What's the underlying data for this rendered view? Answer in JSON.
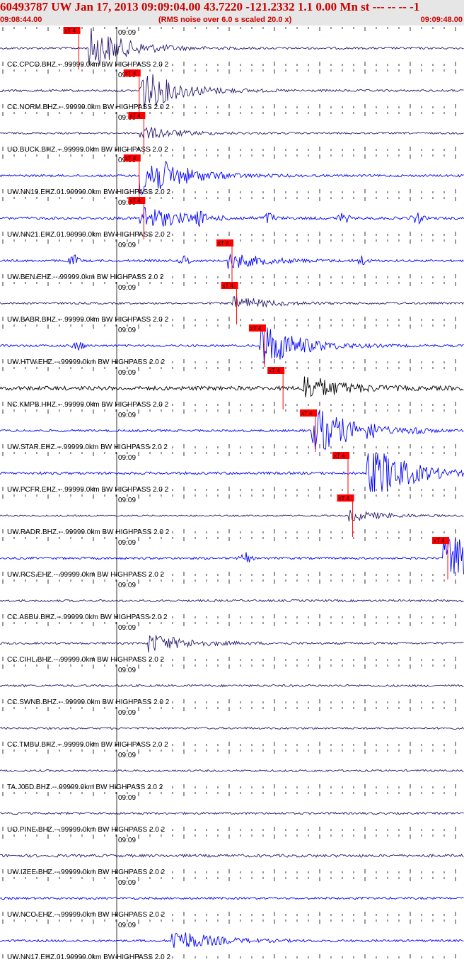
{
  "header": {
    "title": "60493787 UW Jan 17, 2013 09:09:04.00   43.7220 -121.2332  1.1 0.00 Mn st --- -- --   -1",
    "start_time": "09:08:44.00",
    "note": "(RMS noise over 6.0 s scaled 20.0 x)",
    "end_time": "09:09:48.00"
  },
  "minute_label": "09:09",
  "pick_label": "xT 4",
  "colors": {
    "background": "#ffffff",
    "header_bg": "#e6e6e6",
    "header_text": "#cc0000",
    "pick": "#ff0000",
    "ticks": "#000000"
  },
  "traces": [
    {
      "label": "CC.CPCO.BHZ.--.99999.0km BW  HIGHPASS  2.0  2",
      "color": "#2b1a6b",
      "pick": 0.17,
      "burst": 0.2,
      "burst_amp": 3.2,
      "noise": 1.0,
      "extra": []
    },
    {
      "label": "CC.NORM.BHZ.--.99999.0km BW  HIGHPASS  2.0  2",
      "color": "#2b1a6b",
      "pick": 0.3,
      "burst": 0.31,
      "burst_amp": 3.2,
      "noise": 1.0,
      "extra": []
    },
    {
      "label": "UO.BUCK.BHZ.--.99999.0km BW  HIGHPASS  2.0  2",
      "color": "#2b1a6b",
      "pick": 0.31,
      "burst": 0.31,
      "burst_amp": 1.0,
      "noise": 0.8,
      "extra": []
    },
    {
      "label": "UW.NN19.EHZ.01.99999.0km BW  HIGHPASS  2.0  2",
      "color": "#0000ff",
      "pick": 0.3,
      "burst": 0.31,
      "burst_amp": 4.0,
      "noise": 1.0,
      "extra": []
    },
    {
      "label": "UW.NN21.EHZ.01.99999.0km BW  HIGHPASS  2.0  2",
      "color": "#0000ff",
      "pick": 0.31,
      "burst": 0.31,
      "burst_amp": 2.0,
      "noise": 1.2,
      "extra": [
        0.43,
        0.58,
        0.74,
        0.9
      ]
    },
    {
      "label": "UW.BEN.EHZ.--.99999.0km BW  HIGHPASS  2.0  2",
      "color": "#0000ff",
      "pick": 0.5,
      "burst": 0.5,
      "burst_amp": 1.2,
      "noise": 1.0,
      "extra": [
        0.16,
        0.4,
        0.78
      ]
    },
    {
      "label": "UW.BABR.BHZ.--.99999.0km BW  HIGHPASS  2.0  2",
      "color": "#2b1a6b",
      "pick": 0.51,
      "burst": 0.51,
      "burst_amp": 1.0,
      "noise": 0.9,
      "extra": []
    },
    {
      "label": "UW.HTW.EHZ.--.99999.0km BW  HIGHPASS  2.0  2",
      "color": "#0000ff",
      "pick": 0.57,
      "burst": 0.57,
      "burst_amp": 3.5,
      "noise": 1.0,
      "extra": [
        0.17
      ]
    },
    {
      "label": "NC.KMPB.HHZ.--.99999.0km BW  HIGHPASS  2.0  2",
      "color": "#000000",
      "pick": 0.61,
      "burst": 0.66,
      "burst_amp": 2.0,
      "noise": 1.8,
      "extra": []
    },
    {
      "label": "UW.STAR.EHZ.--.99999.0km BW  HIGHPASS  2.0  2",
      "color": "#0000ff",
      "pick": 0.68,
      "burst": 0.68,
      "burst_amp": 4.0,
      "noise": 1.0,
      "extra": [
        0.8,
        0.9
      ]
    },
    {
      "label": "UW.PCFR.EHZ.--.99999.0km BW  HIGHPASS  2.0  2",
      "color": "#0000ff",
      "pick": 0.75,
      "burst": 0.8,
      "burst_amp": 5.0,
      "noise": 1.2,
      "extra": []
    },
    {
      "label": "UW.RADR.BHZ.--.99999.0km BW  HIGHPASS  2.0  2",
      "color": "#2b1a6b",
      "pick": 0.76,
      "burst": 0.76,
      "burst_amp": 0.8,
      "noise": 0.7,
      "extra": []
    },
    {
      "label": "UW.RCS.EHZ.--.99999.0km BW  HIGHPASS  2.0  2",
      "color": "#0000ff",
      "pick": 0.965,
      "burst": 0.965,
      "burst_amp": 4.5,
      "noise": 1.0,
      "extra": [
        0.53
      ]
    },
    {
      "label": "CC.ASBU.BHZ.--.99999.0km BW  HIGHPASS  2.0  2",
      "color": "#2b1a6b",
      "pick": null,
      "burst": null,
      "burst_amp": 0,
      "noise": 1.0,
      "extra": []
    },
    {
      "label": "CC.CIHL.BHZ.--.99999.0km BW  HIGHPASS  2.0  2",
      "color": "#2b1a6b",
      "pick": null,
      "burst": 0.33,
      "burst_amp": 1.4,
      "noise": 1.0,
      "extra": []
    },
    {
      "label": "CC.SWNB.BHZ.--.99999.0km BW  HIGHPASS  2.0  2",
      "color": "#2b1a6b",
      "pick": null,
      "burst": null,
      "burst_amp": 0,
      "noise": 1.0,
      "extra": []
    },
    {
      "label": "CC.TMBU.BHZ.--.99999.0km BW  HIGHPASS  2.0  2",
      "color": "#2b1a6b",
      "pick": null,
      "burst": null,
      "burst_amp": 0,
      "noise": 0.9,
      "extra": []
    },
    {
      "label": "TA.J05D.BHZ.--.99999.0km BW  HIGHPASS  2.0  2",
      "color": "#2b1a6b",
      "pick": null,
      "burst": null,
      "burst_amp": 0,
      "noise": 0.9,
      "extra": []
    },
    {
      "label": "UO.PINE.BHZ.--.99999.0km BW  HIGHPASS  2.0  2",
      "color": "#2b1a6b",
      "pick": null,
      "burst": null,
      "burst_amp": 0,
      "noise": 1.0,
      "extra": []
    },
    {
      "label": "UW.IZEE.BHZ.--.99999.0km BW  HIGHPASS  2.0  2",
      "color": "#2b1a6b",
      "pick": null,
      "burst": null,
      "burst_amp": 0,
      "noise": 1.3,
      "extra": []
    },
    {
      "label": "UW.NCO.EHZ.--.99999.0km BW  HIGHPASS  2.0  2",
      "color": "#0000ff",
      "pick": null,
      "burst": null,
      "burst_amp": 0,
      "noise": 1.0,
      "extra": []
    },
    {
      "label": "UW.NN17.EHZ.01.99999.0km BW  HIGHPASS  2.0  2",
      "color": "#0000ff",
      "pick": null,
      "burst": 0.38,
      "burst_amp": 1.8,
      "noise": 1.0,
      "extra": []
    }
  ]
}
